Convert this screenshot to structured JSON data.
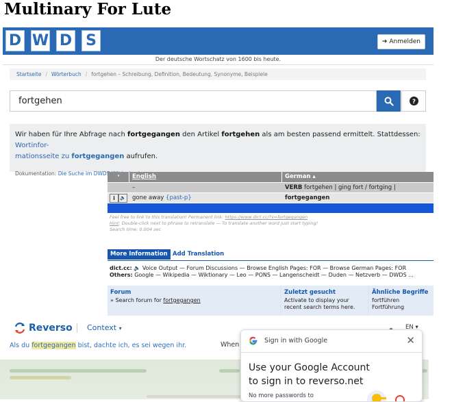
{
  "page": {
    "title": "Multinary For Lute"
  },
  "dwds": {
    "logo_letters": [
      "D",
      "W",
      "D",
      "S"
    ],
    "login_label": "Anmelden",
    "tagline": "Der deutsche Wortschatz von 1600 bis heute.",
    "breadcrumb": [
      "Startseite",
      "Wörterbuch",
      "fortgehen – Schreibung, Definition, Bedeutung, Synonyme, Beispiele"
    ],
    "search": {
      "value": "fortgehen"
    },
    "info": {
      "t1": "Wir haben für Ihre Abfrage nach ",
      "query": "fortgegangen",
      "t2": " den Artikel ",
      "article": "fortgehen",
      "t3": " als am besten passend ermittelt. Stattdessen: ",
      "link1": "Wortinfor-",
      "link2": "mationsseite zu ",
      "link_word": "fortgegangen",
      "t4": " aufrufen.",
      "doc_label": "Dokumentation: ",
      "doc_link": "Die Suche im DWDS-Wörterbuch"
    }
  },
  "dictcc": {
    "col_english": "English",
    "col_german": "German ▴",
    "row1_left": "–",
    "row1_right_tag": "VERB",
    "row1_right_a": "fortgehen | ging fort / fortging | ",
    "row1_right_b": "fortgegangen",
    "row2_left": "gone away",
    "row2_left_tag": "{past-p}",
    "row2_right": "fortgegangen",
    "info_line1": "Feel free to link to this translation! Permanent link: ",
    "info_link": "https://www.dict.cc/?s=fortgegangen",
    "info_line2_pre": "Hint",
    "info_line2": ": Double-click next to phrase to retranslate — To translate another word just start typing!",
    "info_line3": "Search time: 0.004 sec",
    "tab_more": "More Information",
    "tab_add": "Add Translation",
    "links_label1": "dict.cc:",
    "links_text1": "🔈 Voice Output — Forum Discussions — Browse English Pages: FOR — Browse German Pages: FOR",
    "links_label2": "Others:",
    "links_text2": "Google — Wikipedia — Wiktionary — Leo — PONS — Langenscheidt — Duden — Netzverb — DWDS ...",
    "forum_title": "Forum",
    "forum_text": "» Search forum for ",
    "forum_word": "fortgegangen",
    "recent_title": "Zuletzt gesucht",
    "recent_text": "Activate to display your recent search terms here.",
    "similar_title": "Ähnliche Begriffe",
    "similar_items": [
      "fortführen",
      "Fortführung"
    ]
  },
  "reverso": {
    "name": "Reverso",
    "context": "Context",
    "lang": "EN",
    "example_pre": "Als du ",
    "example_hl": "fortgegangen",
    "example_post": " bist, dachte ich, es sei wegen ihr.",
    "when": "When"
  },
  "google": {
    "header": "Sign in with Google",
    "main": "Use your Google Account to sign in to reverso.net",
    "sub": "No more passwords to"
  },
  "colors": {
    "dwds_blue": "#2a6ab4",
    "dict_blue": "#1656d8",
    "reverso_blue": "#1b5fa8",
    "highlight": "#f2e89a"
  }
}
